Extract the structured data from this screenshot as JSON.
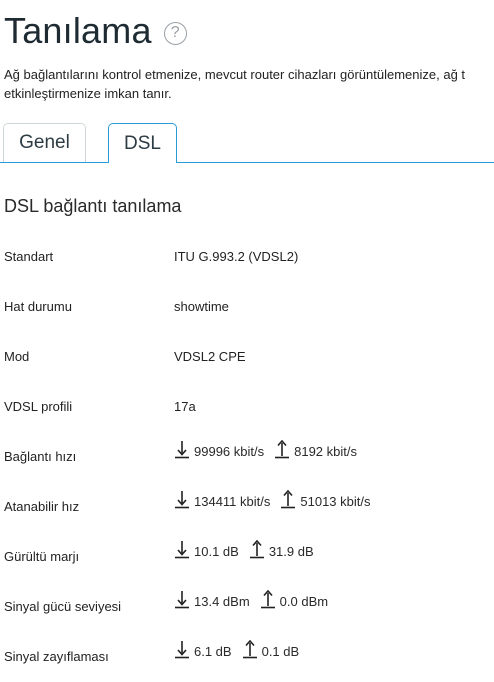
{
  "page": {
    "title": "Tanılama",
    "help_icon": "question-circle-icon",
    "description_line1": "Ağ bağlantılarını kontrol etmenize, mevcut router cihazları görüntülemenize, ağ t",
    "description_line2": "etkinleştirmenize imkan tanır."
  },
  "tabs": [
    {
      "label": "Genel",
      "active": false
    },
    {
      "label": "DSL",
      "active": true
    }
  ],
  "section": {
    "title": "DSL bağlantı tanılama"
  },
  "rows": [
    {
      "label": "Standart",
      "value": "ITU G.993.2 (VDSL2)"
    },
    {
      "label": "Hat durumu",
      "value": "showtime"
    },
    {
      "label": "Mod",
      "value": "VDSL2 CPE"
    },
    {
      "label": "VDSL profili",
      "value": "17a"
    },
    {
      "label": "Bağlantı hızı",
      "down": "99996 kbit/s",
      "up": "8192 kbit/s"
    },
    {
      "label": "Atanabilir hız",
      "down": "134411 kbit/s",
      "up": "51013 kbit/s"
    },
    {
      "label": "Gürültü marjı",
      "down": "10.1 dB",
      "up": "31.9 dB"
    },
    {
      "label": "Sinyal gücü seviyesi",
      "down": "13.4 dBm",
      "up": "0.0 dBm"
    },
    {
      "label": "Sinyal zayıflaması",
      "down": "6.1 dB",
      "up": "0.1 dB"
    }
  ],
  "icons": {
    "down": "download-arrow-icon",
    "up": "upload-arrow-icon"
  },
  "colors": {
    "accent": "#2a9bd6",
    "tab_border": "#cfd6da"
  }
}
